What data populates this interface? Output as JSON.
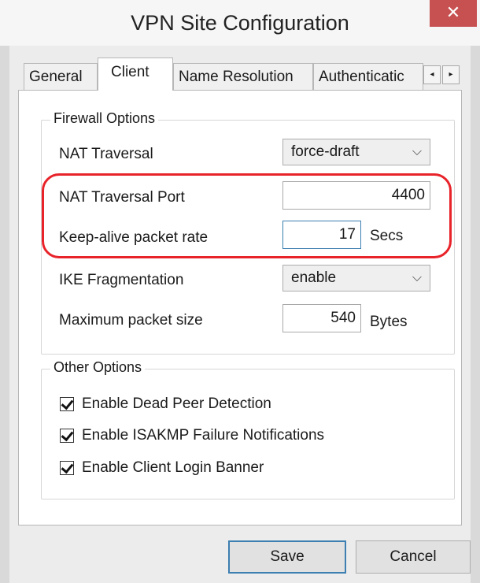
{
  "window": {
    "title": "VPN Site Configuration",
    "close_glyph": "✕"
  },
  "tabs": [
    {
      "label": "General",
      "active": false
    },
    {
      "label": "Client",
      "active": true
    },
    {
      "label": "Name Resolution",
      "active": false
    },
    {
      "label": "Authenticatic",
      "active": false
    }
  ],
  "tab_scroll": {
    "left_glyph": "◂",
    "right_glyph": "▸"
  },
  "firewall": {
    "title": "Firewall Options",
    "nat_traversal": {
      "label": "NAT Traversal",
      "value": "force-draft"
    },
    "nat_port": {
      "label": "NAT Traversal Port",
      "value": "4400"
    },
    "keepalive": {
      "label": "Keep-alive packet rate",
      "value": "17",
      "unit": "Secs"
    },
    "ike_frag": {
      "label": "IKE Fragmentation",
      "value": "enable"
    },
    "max_packet": {
      "label": "Maximum packet size",
      "value": "540",
      "unit": "Bytes"
    }
  },
  "other": {
    "title": "Other Options",
    "options": [
      {
        "label": "Enable Dead Peer Detection",
        "checked": true
      },
      {
        "label": "Enable ISAKMP Failure Notifications",
        "checked": true
      },
      {
        "label": "Enable Client Login Banner",
        "checked": true
      }
    ]
  },
  "buttons": {
    "save": "Save",
    "cancel": "Cancel"
  },
  "colors": {
    "highlight": "#e8232a",
    "close": "#c75050",
    "focus": "#3c7fb1"
  }
}
